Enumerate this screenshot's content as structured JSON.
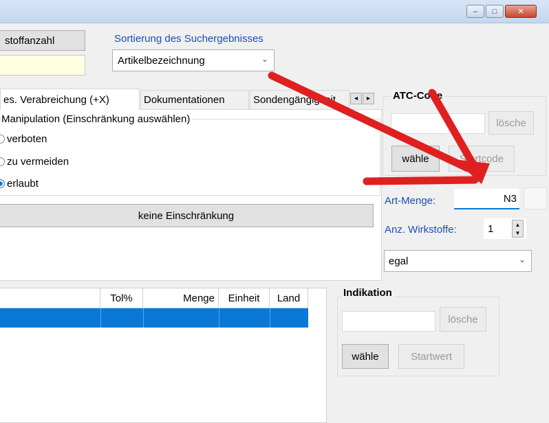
{
  "window": {
    "minimize_glyph": "–",
    "maximize_glyph": "□",
    "close_glyph": "✕"
  },
  "top_left": {
    "button_label": "stoffanzahl"
  },
  "sort": {
    "label": "Sortierung des Suchergebnisses",
    "selected": "Artikelbezeichnung"
  },
  "tabs": [
    {
      "label": "es. Verabreichung (+X)"
    },
    {
      "label": "Dokumentationen"
    },
    {
      "label": "Sondengängigkeit"
    }
  ],
  "tab_scroll": {
    "left": "◂",
    "right": "▸"
  },
  "manipulation": {
    "title": "Manipulation (Einschränkung auswählen)",
    "options": [
      {
        "label": "verboten",
        "selected": false
      },
      {
        "label": "zu vermeiden",
        "selected": false
      },
      {
        "label": "erlaubt",
        "selected": true
      }
    ],
    "reset_button": "keine Einschränkung"
  },
  "atc": {
    "title": "ATC-Code",
    "clear_button": "lösche",
    "choose_button": "wähle",
    "startcode_button": "Startcode"
  },
  "art_menge": {
    "label": "Art-Menge:",
    "value": "N3"
  },
  "wirkstoffe": {
    "label": "Anz. Wirkstoffe:",
    "value": "1",
    "select_value": "egal"
  },
  "indikation": {
    "title": "Indikation",
    "clear_button": "lösche",
    "choose_button": "wähle",
    "startwert_button": "Startwert"
  },
  "table": {
    "columns": [
      "Tol%",
      "Menge",
      "Einheit",
      "Land"
    ]
  },
  "colors": {
    "selection": "#0a78d7",
    "arrow": "#e02020",
    "link": "#1b4dbb"
  }
}
